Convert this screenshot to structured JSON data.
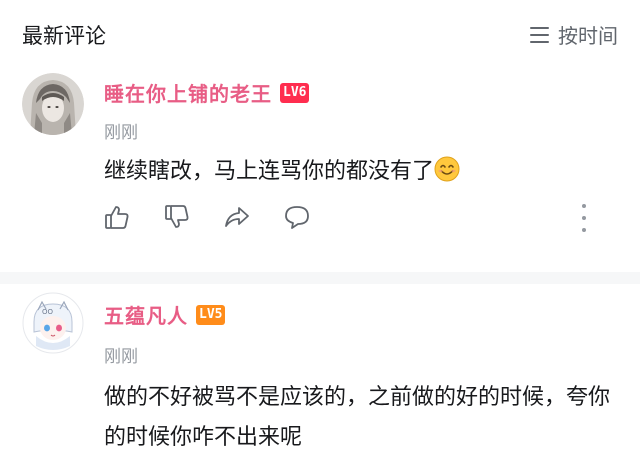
{
  "header": {
    "title": "最新评论",
    "sort_label": "按时间",
    "sort_icon": "list-icon"
  },
  "comments": [
    {
      "username": "睡在你上铺的老王",
      "level": "LV6",
      "time": "刚刚",
      "text": "继续瞎改，马上连骂你的都没有了",
      "emoji": "smile-emoji",
      "actions": [
        "thumbs-up-icon",
        "thumbs-down-icon",
        "share-icon",
        "reply-icon",
        "more-icon"
      ]
    },
    {
      "username": "五蕴凡人",
      "level": "LV5",
      "time": "刚刚",
      "text": "做的不好被骂不是应该的，之前做的好的时候，夸你的时候你咋不出来呢"
    }
  ],
  "colors": {
    "username": "#e85d85",
    "lv6": "#ff2d4f",
    "lv5": "#ff8c1a",
    "muted": "#9499a0",
    "divider": "#f6f7f8"
  }
}
